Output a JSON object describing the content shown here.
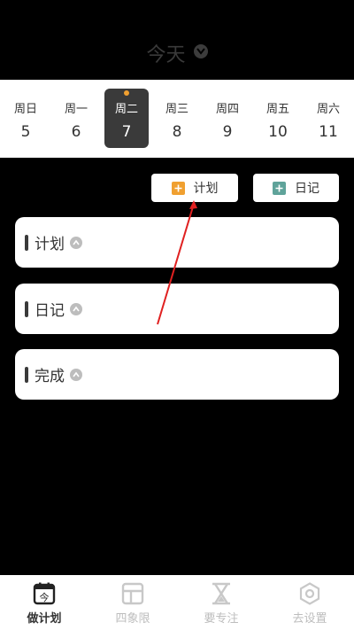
{
  "header": {
    "title": "今天"
  },
  "week": {
    "days": [
      {
        "name": "周日",
        "num": "5"
      },
      {
        "name": "周一",
        "num": "6"
      },
      {
        "name": "周二",
        "num": "7"
      },
      {
        "name": "周三",
        "num": "8"
      },
      {
        "name": "周四",
        "num": "9"
      },
      {
        "name": "周五",
        "num": "10"
      },
      {
        "name": "周六",
        "num": "11"
      }
    ],
    "selected_index": 2
  },
  "actions": {
    "add_plan": "计划",
    "add_diary": "日记"
  },
  "sections": [
    {
      "title": "计划"
    },
    {
      "title": "日记"
    },
    {
      "title": "完成"
    }
  ],
  "tabs": [
    {
      "label": "做计划",
      "icon": "calendar-today-icon",
      "active": true
    },
    {
      "label": "四象限",
      "icon": "quadrant-layout-icon",
      "active": false
    },
    {
      "label": "要专注",
      "icon": "hourglass-icon",
      "active": false
    },
    {
      "label": "去设置",
      "icon": "hexagon-settings-icon",
      "active": false
    }
  ],
  "calendar_icon_char": "今",
  "colors": {
    "accent_orange": "#f0a030",
    "accent_teal": "#5fa39a",
    "annotation_red": "#e02020",
    "dark": "#3a3a3a"
  }
}
